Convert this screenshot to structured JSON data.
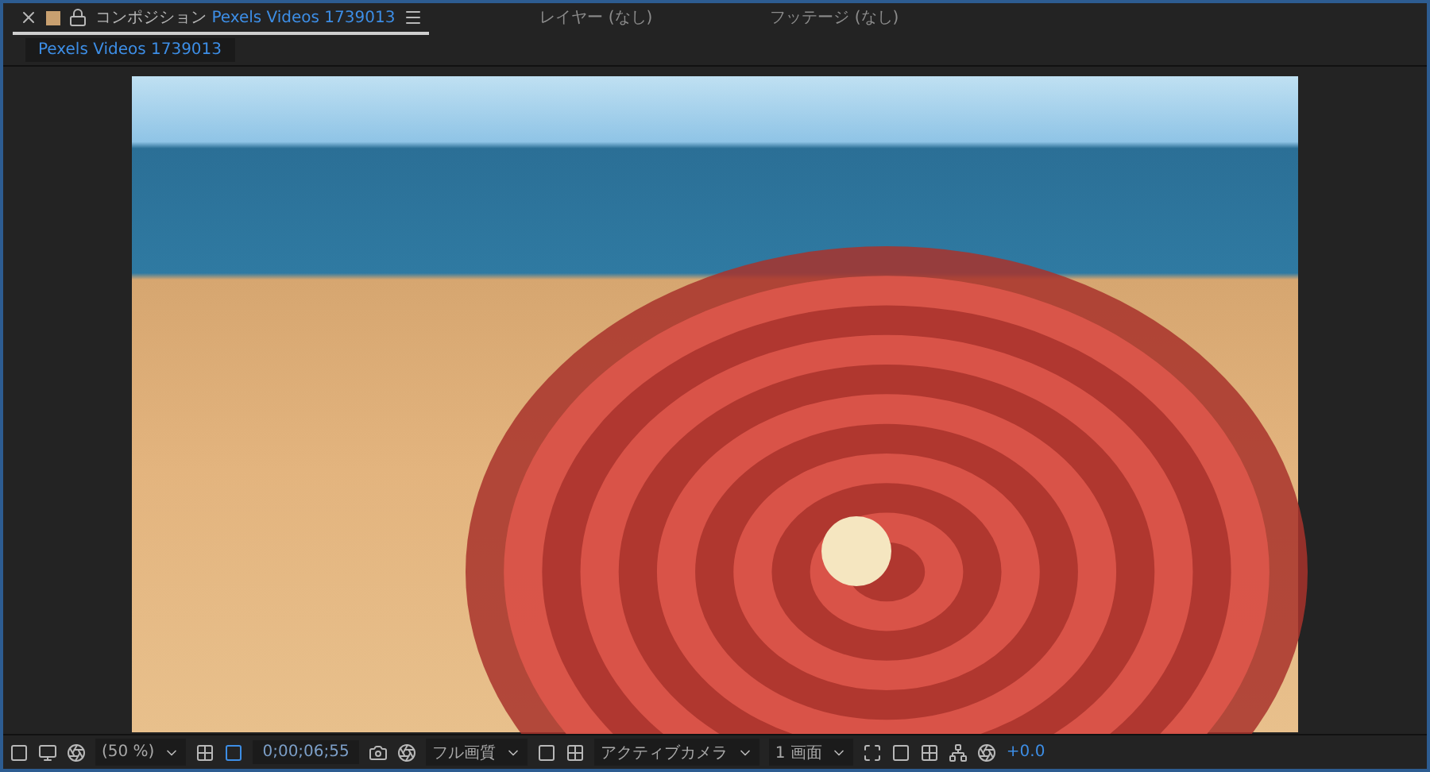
{
  "tabs": [
    {
      "kind": "composition",
      "prefix": "コンポジション",
      "name": "Pexels Videos 1739013",
      "selected": true
    },
    {
      "kind": "plain",
      "prefix": "レイヤー (なし)",
      "selected": false
    },
    {
      "kind": "plain",
      "prefix": "フッテージ (なし)",
      "selected": false
    }
  ],
  "subtab": {
    "label": "Pexels Videos 1739013"
  },
  "toolbar": {
    "zoom": "(50 %)",
    "timecode": "0;00;06;55",
    "resolution": "フル画質",
    "view": "アクティブカメラ",
    "layout": "1 画面",
    "exposure": "+0.0"
  }
}
